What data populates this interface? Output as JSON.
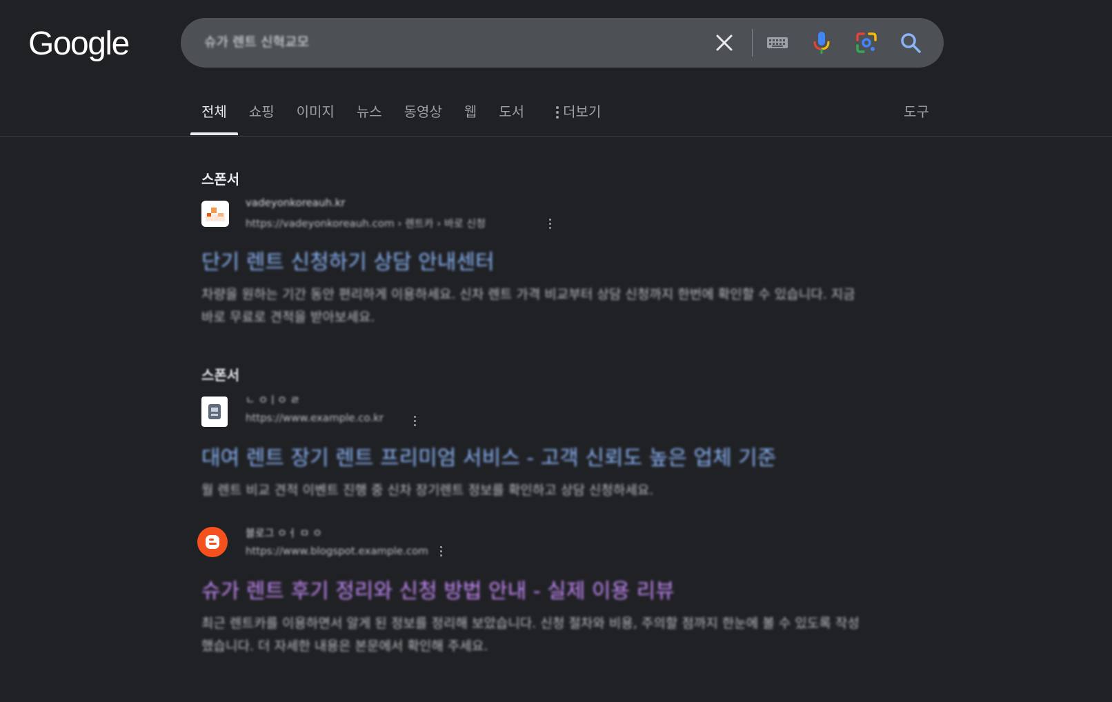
{
  "header": {
    "logo": "Google",
    "search": {
      "value": "슈가 렌트 신혁교모",
      "placeholder": ""
    }
  },
  "tabs": [
    {
      "label": "전체",
      "active": true
    },
    {
      "label": "쇼핑"
    },
    {
      "label": "이미지"
    },
    {
      "label": "뉴스"
    },
    {
      "label": "동영상"
    },
    {
      "label": "웹"
    },
    {
      "label": "도서"
    }
  ],
  "more_label": "더보기",
  "tools_label": "도구",
  "results": [
    {
      "label": "스폰서",
      "site_name": "vadeyonkoreauh.kr",
      "url": "https://vadeyonkoreauh.com › 렌트카 › 바로 신청",
      "title": "단기 렌트 신청하기 상담 안내센터",
      "description": "차량을 원하는 기간 동안 편리하게 이용하세요. 신차 렌트 가격 비교부터 상담 신청까지 한번에 확인할 수 있습니다. 지금 바로 무료로 견적을 받아보세요.",
      "favicon_color": "#ffffff"
    },
    {
      "label": "스폰서",
      "site_name": "ㄴ ㅇㅣㅇ ㄹ",
      "url": "https://www.example.co.kr",
      "title": "대여 렌트 장기 렌트 프리미엄 서비스 - 고객 신뢰도 높은 업체 기준",
      "description": "월 렌트 비교 견적 이벤트 진행 중 신차 장기렌트 정보를 확인하고 상담 신청하세요.",
      "favicon_color": "#ffffff"
    },
    {
      "label": "",
      "site_name": "블로그 ㅇㅓ ㅁ ㅇ",
      "url": "https://www.blogspot.example.com",
      "title": "슈가 렌트 후기 정리와 신청 방법 안내 - 실제 이용 리뷰",
      "description": "최근 렌트카를 이용하면서 알게 된 정보를 정리해 보았습니다. 신청 절차와 비용, 주의할 점까지 한눈에 볼 수 있도록 작성했습니다. 더 자세한 내용은 본문에서 확인해 주세요.",
      "favicon_color": "#f4511e"
    }
  ]
}
